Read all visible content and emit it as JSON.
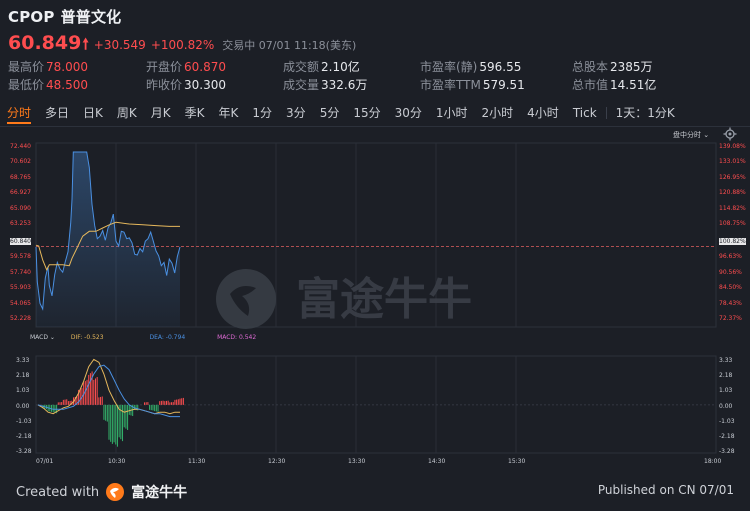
{
  "header": {
    "ticker": "CPOP",
    "name": "普普文化",
    "price": "60.849",
    "arrow": "🠕",
    "change": "+30.549",
    "change_pct": "+100.82%",
    "status": "交易中  07/01 11:18(美东)"
  },
  "stats": [
    [
      {
        "label": "最高价",
        "value": "78.000",
        "tone": "red"
      },
      {
        "label": "最低价",
        "value": "48.500",
        "tone": "red"
      }
    ],
    [
      {
        "label": "开盘价",
        "value": "60.870",
        "tone": "red"
      },
      {
        "label": "昨收价",
        "value": "30.300",
        "tone": "white"
      }
    ],
    [
      {
        "label": "成交额",
        "value": "2.10亿",
        "tone": "white"
      },
      {
        "label": "成交量",
        "value": "332.6万",
        "tone": "white"
      }
    ],
    [
      {
        "label": "市盈率(静)",
        "value": "596.55",
        "tone": "white"
      },
      {
        "label": "市盈率TTM",
        "value": "579.51",
        "tone": "white"
      }
    ],
    [
      {
        "label": "总股本",
        "value": "2385万",
        "tone": "white"
      },
      {
        "label": "总市值",
        "value": "14.51亿",
        "tone": "white"
      }
    ]
  ],
  "tabs": [
    "分时",
    "多日",
    "日K",
    "周K",
    "月K",
    "季K",
    "年K",
    "1分",
    "3分",
    "5分",
    "15分",
    "30分",
    "1小时",
    "2小时",
    "4小时",
    "Tick",
    "1天：1分K"
  ],
  "active_tab": 0,
  "chart_toolbar": {
    "mode_label": "盘中分时",
    "mode_icon": "chevron-down-icon",
    "settings_icon": "gear-icon"
  },
  "chart_data": {
    "type": "line",
    "price_axis_left": [
      "72.440",
      "70.602",
      "68.765",
      "66.927",
      "65.090",
      "63.253",
      "60.840",
      "59.578",
      "57.740",
      "55.903",
      "54.065",
      "52.228"
    ],
    "price_axis_right": [
      "139.08%",
      "133.01%",
      "126.95%",
      "120.88%",
      "114.82%",
      "108.75%",
      "100.82%",
      "96.63%",
      "90.56%",
      "84.50%",
      "78.43%",
      "72.37%"
    ],
    "x_ticks": [
      "07/01",
      "10:30",
      "11:30",
      "12:30",
      "13:30",
      "14:30",
      "15:30",
      "18:00"
    ],
    "series": [
      {
        "name": "price",
        "color": "#4a90e2",
        "x": [
          "09:30",
          "09:31",
          "09:33",
          "09:35",
          "09:37",
          "09:39",
          "09:40",
          "09:42",
          "09:44",
          "09:46",
          "09:48",
          "09:50",
          "09:52",
          "09:54",
          "09:56",
          "09:57",
          "09:58",
          "10:00",
          "10:01",
          "10:03",
          "10:05",
          "10:06",
          "10:08",
          "10:10",
          "10:12",
          "10:14",
          "10:16",
          "10:18",
          "10:20",
          "10:22",
          "10:24",
          "10:26",
          "10:28",
          "10:30",
          "10:32",
          "10:34",
          "10:36",
          "10:38",
          "10:40",
          "10:42",
          "10:44",
          "10:46",
          "10:48",
          "10:50",
          "10:52",
          "10:54",
          "10:56",
          "10:58",
          "11:00",
          "11:02",
          "11:04",
          "11:06",
          "11:08",
          "11:10",
          "11:12",
          "11:14",
          "11:16",
          "11:18"
        ],
        "y": [
          60.8,
          56.5,
          53.9,
          53.2,
          57.0,
          58.4,
          56.1,
          54.8,
          57.4,
          58.9,
          58.1,
          57.7,
          59.0,
          60.2,
          63.7,
          66.6,
          72.4,
          72.4,
          72.4,
          72.4,
          72.4,
          72.4,
          72.4,
          70.5,
          66.0,
          63.4,
          61.8,
          62.1,
          62.8,
          61.6,
          63.1,
          63.7,
          64.8,
          61.5,
          60.9,
          62.7,
          62.6,
          61.8,
          61.9,
          61.3,
          59.9,
          59.8,
          60.6,
          60.2,
          61.5,
          61.8,
          62.6,
          61.5,
          60.3,
          59.7,
          58.5,
          58.9,
          57.3,
          59.3,
          58.8,
          57.6,
          59.6,
          60.8
        ]
      },
      {
        "name": "average",
        "color": "#e6b85c",
        "x": [
          "09:30",
          "09:32",
          "09:35",
          "09:38",
          "09:40",
          "09:45",
          "09:50",
          "09:55",
          "09:57",
          "10:00",
          "10:05",
          "10:10",
          "10:15",
          "10:20",
          "10:25",
          "10:30",
          "10:40",
          "10:50",
          "11:00",
          "11:10",
          "11:18"
        ],
        "y": [
          61.0,
          60.9,
          59.2,
          58.0,
          58.6,
          58.6,
          58.6,
          58.5,
          59.4,
          60.4,
          62.1,
          62.7,
          62.7,
          63.1,
          63.5,
          63.8,
          63.6,
          63.5,
          63.4,
          63.3,
          63.3
        ]
      }
    ],
    "y_range": [
      51.0,
      73.5
    ],
    "prev_close": 30.3,
    "reference_price": 60.84,
    "macd": {
      "labels": {
        "title": "MACD",
        "dif": "DIF: -0.523",
        "dea": "DEA: -0.794",
        "macd": "MACD: 0.542"
      },
      "axis_left": [
        "3.33",
        "2.18",
        "1.03",
        "0.00",
        "-1.03",
        "-2.18",
        "-3.28"
      ],
      "axis_right": [
        "3.33",
        "2.18",
        "1.03",
        "0.00",
        "-1.03",
        "-2.18",
        "-3.28"
      ],
      "y_range": [
        -3.28,
        3.33
      ],
      "dif_color": "#e6b85c",
      "dea_color": "#4a90e2",
      "hist_pos_color": "#ff4d4f",
      "hist_neg_color": "#33b36b",
      "dif": [
        0.0,
        -0.2,
        -0.5,
        -0.6,
        -0.4,
        -0.2,
        -0.1,
        0.2,
        0.8,
        1.6,
        2.6,
        3.1,
        2.9,
        2.1,
        1.0,
        0.3,
        -0.3,
        -0.5,
        -0.4,
        -0.3,
        -0.3,
        -0.4,
        -0.5,
        -0.6,
        -0.5,
        -0.5,
        -0.6,
        -0.5,
        -0.5
      ],
      "dea": [
        0.0,
        -0.1,
        -0.2,
        -0.3,
        -0.3,
        -0.3,
        -0.2,
        -0.1,
        0.2,
        0.7,
        1.4,
        2.1,
        2.6,
        2.7,
        2.4,
        1.7,
        1.0,
        0.4,
        0.0,
        -0.2,
        -0.3,
        -0.4,
        -0.5,
        -0.6,
        -0.6,
        -0.7,
        -0.8,
        -0.8,
        -0.8
      ],
      "hist": [
        0.0,
        -0.3,
        -0.5,
        -0.6,
        0.2,
        0.4,
        0.3,
        0.6,
        1.2,
        1.8,
        2.4,
        2.0,
        0.6,
        -1.2,
        -2.8,
        -3.0,
        -2.6,
        -1.8,
        -0.8,
        -0.4,
        0.0,
        0.2,
        -0.4,
        -0.5,
        0.3,
        0.3,
        0.2,
        0.4,
        0.5
      ]
    }
  },
  "watermark": "富途牛牛",
  "footer": {
    "created_with": "Created with",
    "brand": "富途牛牛",
    "published": "Published on CN 07/01"
  },
  "colors": {
    "background": "#1c1f26",
    "up": "#ff4d4f",
    "accent": "#ff7a1a",
    "grid": "#2c313b",
    "price_line": "#4a90e2"
  }
}
